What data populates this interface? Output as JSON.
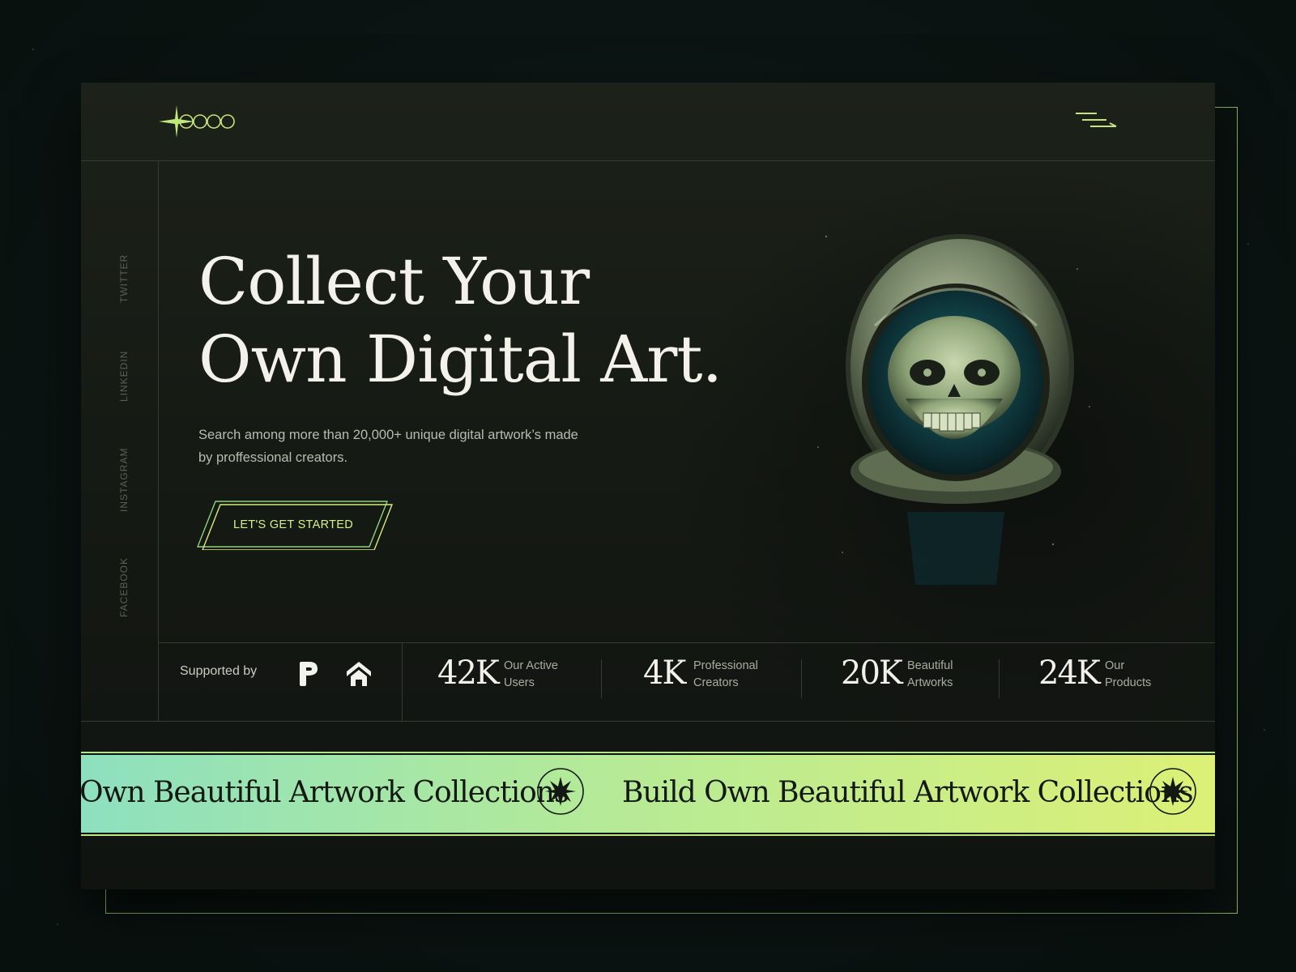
{
  "brand": {
    "logo_name": "logo"
  },
  "nav": {
    "menu_icon": "menu-icon"
  },
  "social_links": [
    "TWITTER",
    "LINKEDIN",
    "INSTAGRAM",
    "FACEBOOK"
  ],
  "hero": {
    "title_line1": "Collect Your",
    "title_line2": "Own Digital Art.",
    "description": "Search among more than 20,000+ unique digital artwork’s made by proffessional creators.",
    "cta_label": "LET'S GET STARTED",
    "image": "astronaut-skull-illustration"
  },
  "supported": {
    "label": "Supported by",
    "icons": [
      "p-brand-icon",
      "house-brand-icon"
    ]
  },
  "stats": [
    {
      "value": "42K",
      "label_line1": "Our Active",
      "label_line2": "Users"
    },
    {
      "value": "4K",
      "label_line1": "Professional",
      "label_line2": "Creators"
    },
    {
      "value": "20K",
      "label_line1": "Beautiful",
      "label_line2": "Artworks"
    },
    {
      "value": "24K",
      "label_line1": "Our",
      "label_line2": "Products"
    }
  ],
  "marquee": {
    "text_partial": "Own Beautiful Artwork Collections",
    "text_full": "Build Own Beautiful Artwork Collections",
    "badge_icon": "star-burst-icon"
  },
  "colors": {
    "accent": "#d6ef8a",
    "gradient_start": "#8de0bf",
    "gradient_end": "#dcf076",
    "background": "#0b1412"
  }
}
